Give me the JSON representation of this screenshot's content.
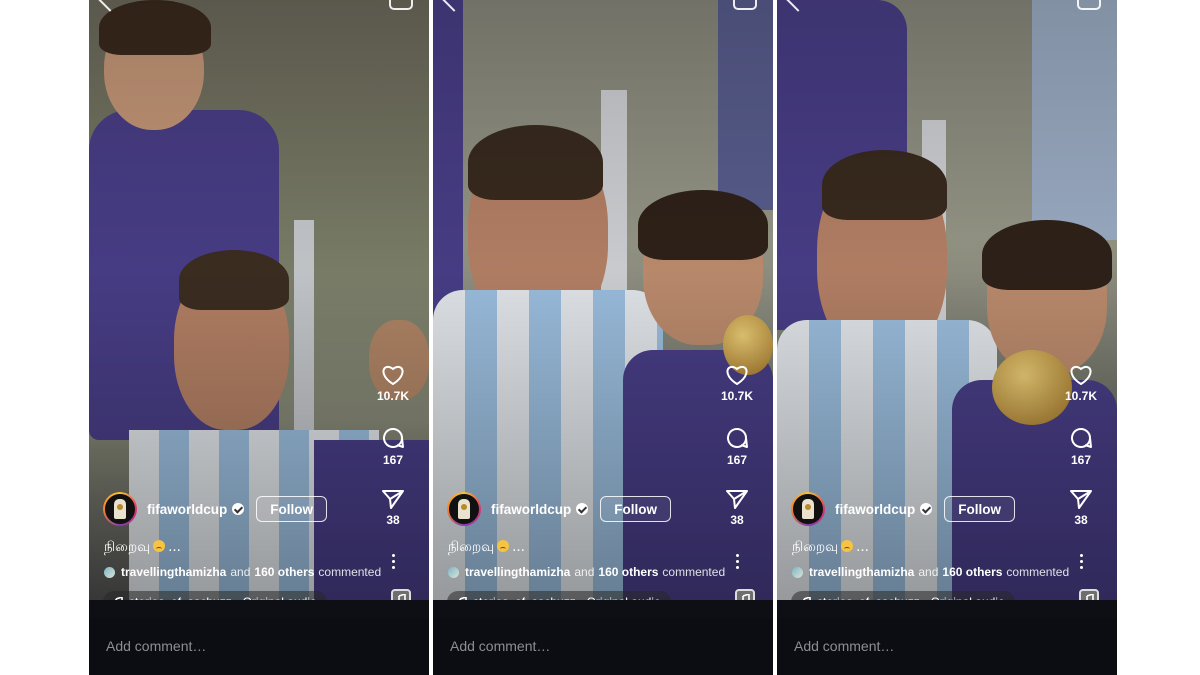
{
  "panels": [
    {
      "account": {
        "username": "fifaworldcup",
        "follow_label": "Follow"
      },
      "actions": {
        "likes": "10.7K",
        "comments": "167",
        "shares": "38"
      },
      "caption": "நிறைவு",
      "caption_suffix": "...",
      "commented": {
        "user": "travellingthamizha",
        "and": "and",
        "others": "160 others",
        "tail": "commented"
      },
      "audio": "stories_of_sachuzz • Original audio",
      "comment_placeholder": "Add comment…"
    },
    {
      "account": {
        "username": "fifaworldcup",
        "follow_label": "Follow"
      },
      "actions": {
        "likes": "10.7K",
        "comments": "167",
        "shares": "38"
      },
      "caption": "நிறைவு",
      "caption_suffix": "...",
      "commented": {
        "user": "travellingthamizha",
        "and": "and",
        "others": "160 others",
        "tail": "commented"
      },
      "audio": "stories_of_sachuzz • Original audio",
      "comment_placeholder": "Add comment…"
    },
    {
      "account": {
        "username": "fifaworldcup",
        "follow_label": "Follow"
      },
      "actions": {
        "likes": "10.7K",
        "comments": "167",
        "shares": "38"
      },
      "caption": "நிறைவு",
      "caption_suffix": "...",
      "commented": {
        "user": "travellingthamizha",
        "and": "and",
        "others": "160 others",
        "tail": "commented"
      },
      "audio": "stories_of_sachuzz • Original audio",
      "comment_placeholder": "Add comment…"
    }
  ],
  "icons": [
    "back-icon",
    "camera-icon",
    "heart-icon",
    "comment-icon",
    "share-icon",
    "more-icon",
    "music-note-icon",
    "verified-icon"
  ],
  "colors": {
    "stripe_blue": "#9fc3e4",
    "purple_kit": "#4a3f8a",
    "follow_border": "#ffffff",
    "background": "#0d0f14"
  }
}
